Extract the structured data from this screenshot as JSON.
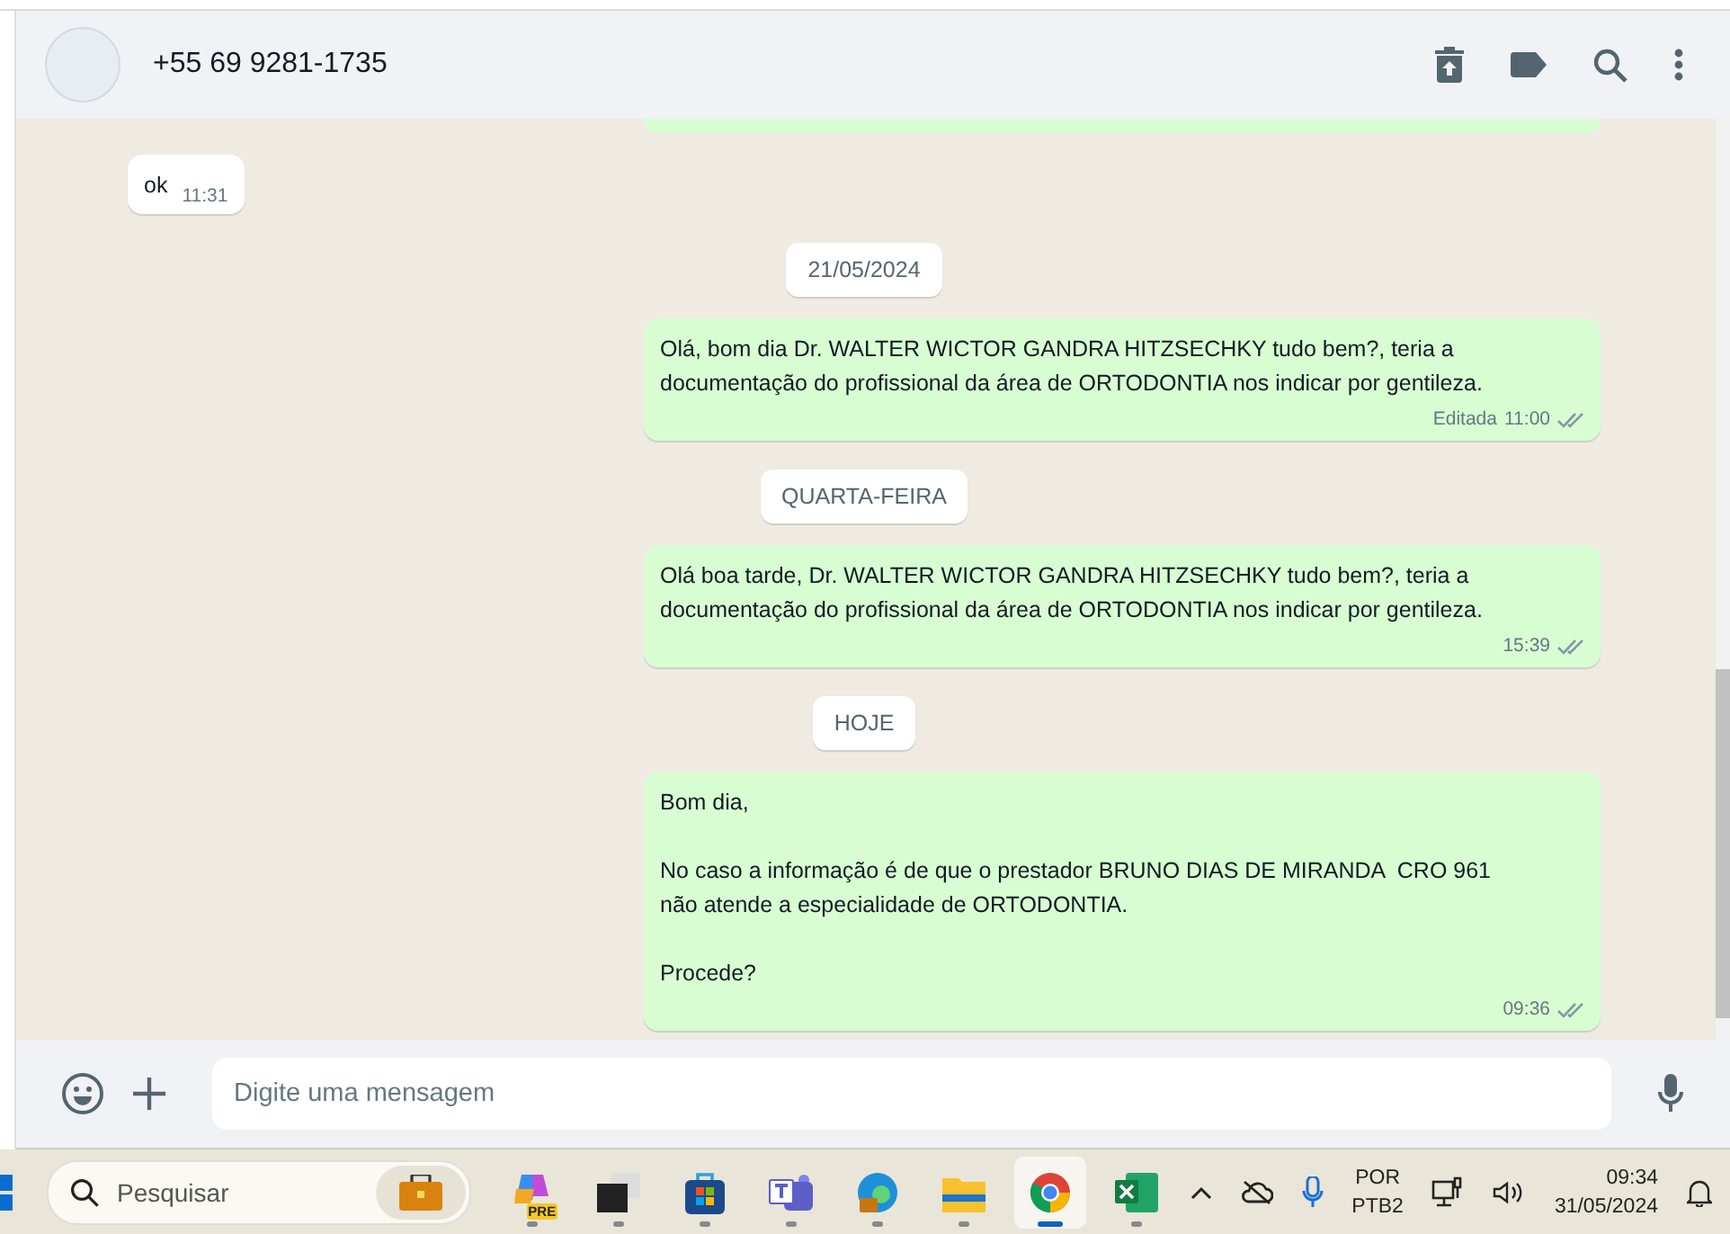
{
  "chat_header": {
    "title": "+55 69 9281-1735"
  },
  "messages": [
    {
      "kind": "cut_outgoing"
    },
    {
      "kind": "incoming",
      "text": "ok",
      "time": "11:31"
    },
    {
      "kind": "date",
      "text": "21/05/2024"
    },
    {
      "kind": "outgoing",
      "text": "Olá, bom dia Dr. WALTER WICTOR GANDRA HITZSECHKY tudo bem?, teria a documentação do profissional da área de ORTODONTIA nos indicar por gentileza.",
      "edited_label": "Editada",
      "time": "11:00",
      "read": false
    },
    {
      "kind": "date",
      "text": "QUARTA-FEIRA"
    },
    {
      "kind": "outgoing",
      "text": "Olá boa tarde, Dr. WALTER WICTOR GANDRA HITZSECHKY tudo bem?, teria a documentação do profissional da área de ORTODONTIA nos indicar por gentileza.",
      "time": "15:39",
      "read": false
    },
    {
      "kind": "date",
      "text": "HOJE"
    },
    {
      "kind": "outgoing",
      "text": "Bom dia,\n\nNo caso a informação é de que o prestador BRUNO DIAS DE MIRANDA  CRO 961\nnão atende a especialidade de ORTODONTIA.\n\nProcede?",
      "time": "09:36",
      "read": false
    }
  ],
  "composer": {
    "placeholder": "Digite uma mensagem"
  },
  "taskbar": {
    "search_placeholder": "Pesquisar",
    "apps": [
      {
        "kind": "copilot",
        "badge": "PRE",
        "active": false
      },
      {
        "kind": "task-view",
        "active": false
      },
      {
        "kind": "store",
        "active": false
      },
      {
        "kind": "teams",
        "active": false
      },
      {
        "kind": "edge",
        "active": false
      },
      {
        "kind": "folder",
        "active": false
      },
      {
        "kind": "chrome",
        "active": true
      },
      {
        "kind": "excel",
        "active": false
      }
    ],
    "language": [
      "POR",
      "PTB2"
    ],
    "time": "09:34",
    "date": "31/05/2024"
  }
}
